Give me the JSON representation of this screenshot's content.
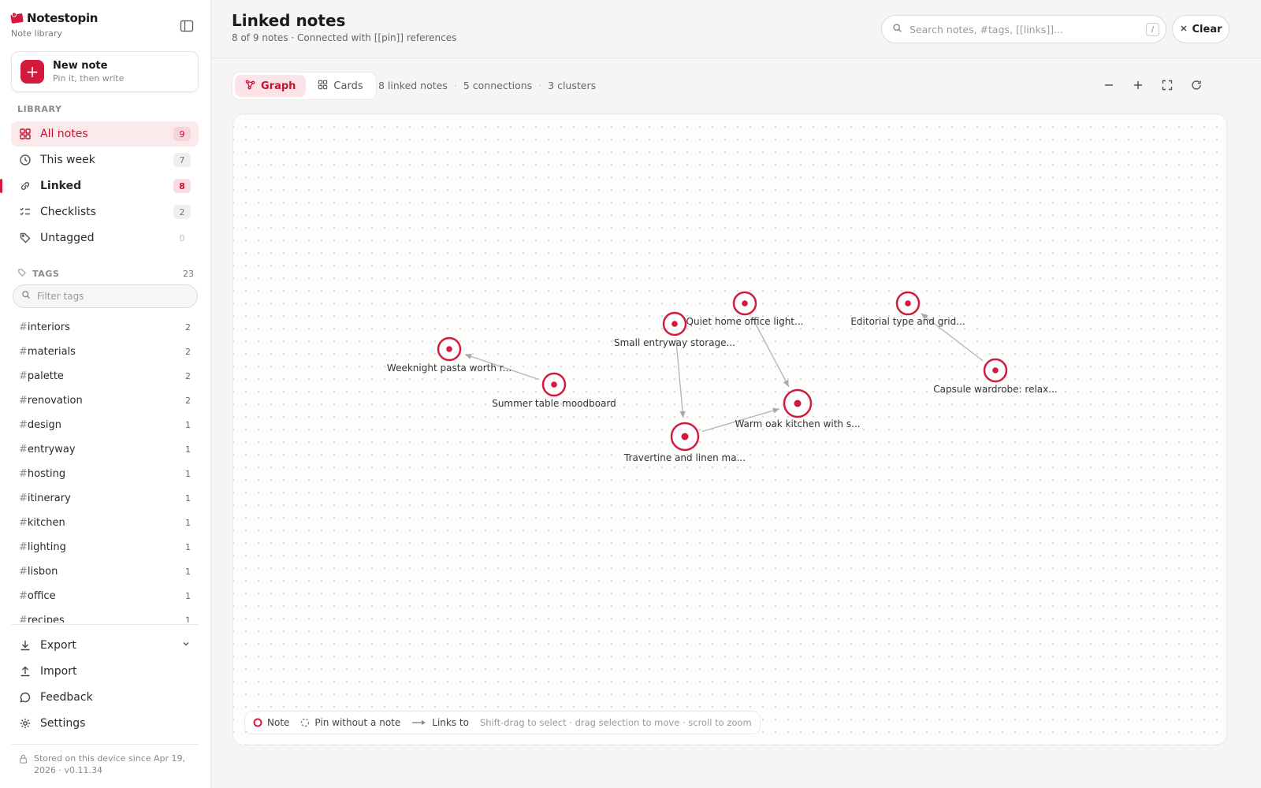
{
  "app": {
    "brand": "Notestopin",
    "brand_sub": "Note library",
    "accent": "#d41a3c"
  },
  "sidebar": {
    "new_note": {
      "title": "New note",
      "sub": "Pin it, then write"
    },
    "library_label": "LIBRARY",
    "nav": [
      {
        "label": "All notes",
        "count": "9",
        "icon": "grid-icon"
      },
      {
        "label": "This week",
        "count": "7",
        "icon": "clock-icon"
      },
      {
        "label": "Linked",
        "count": "8",
        "icon": "link-icon"
      },
      {
        "label": "Checklists",
        "count": "2",
        "icon": "checklist-icon"
      },
      {
        "label": "Untagged",
        "count": "0",
        "icon": "tag-off-icon"
      }
    ],
    "tags_label": "TAGS",
    "tags_count": "23",
    "tag_filter_placeholder": "Filter tags",
    "tags": [
      {
        "name": "interiors",
        "count": "2"
      },
      {
        "name": "materials",
        "count": "2"
      },
      {
        "name": "palette",
        "count": "2"
      },
      {
        "name": "renovation",
        "count": "2"
      },
      {
        "name": "design",
        "count": "1"
      },
      {
        "name": "entryway",
        "count": "1"
      },
      {
        "name": "hosting",
        "count": "1"
      },
      {
        "name": "itinerary",
        "count": "1"
      },
      {
        "name": "kitchen",
        "count": "1"
      },
      {
        "name": "lighting",
        "count": "1"
      },
      {
        "name": "lisbon",
        "count": "1"
      },
      {
        "name": "office",
        "count": "1"
      },
      {
        "name": "recipes",
        "count": "1"
      }
    ],
    "bottom": [
      {
        "label": "Export",
        "icon": "download-icon"
      },
      {
        "label": "Import",
        "icon": "upload-icon"
      },
      {
        "label": "Feedback",
        "icon": "message-icon"
      },
      {
        "label": "Settings",
        "icon": "gear-icon"
      }
    ],
    "footer": "Stored on this device since Apr 19, 2026 · v0.11.34"
  },
  "header": {
    "title": "Linked notes",
    "subtitle": "8 of 9 notes · Connected with [[pin]] references",
    "search_placeholder": "Search notes, #tags, [[links]]...",
    "search_kbd": "/",
    "clear_label": "Clear"
  },
  "view": {
    "tabs": [
      {
        "label": "Graph"
      },
      {
        "label": "Cards"
      }
    ],
    "stats": [
      "8 linked notes",
      "5 connections",
      "3 clusters"
    ]
  },
  "graph": {
    "nodes": [
      {
        "id": "pasta",
        "label": "Weeknight pasta worth r..."
      },
      {
        "id": "summer",
        "label": "Summer table moodboard"
      },
      {
        "id": "entry",
        "label": "Small entryway storage..."
      },
      {
        "id": "office",
        "label": "Quiet home office light..."
      },
      {
        "id": "oak",
        "label": "Warm oak kitchen with s..."
      },
      {
        "id": "trav",
        "label": "Travertine and linen ma..."
      },
      {
        "id": "edit",
        "label": "Editorial type and grid..."
      },
      {
        "id": "caps",
        "label": "Capsule wardrobe: relax..."
      }
    ],
    "edges": [
      {
        "from": "summer",
        "to": "pasta"
      },
      {
        "from": "entry",
        "to": "trav"
      },
      {
        "from": "office",
        "to": "oak"
      },
      {
        "from": "trav",
        "to": "oak"
      },
      {
        "from": "caps",
        "to": "edit"
      }
    ]
  },
  "legend": {
    "note": "Note",
    "pin": "Pin without a note",
    "links": "Links to",
    "hint": "Shift-drag to select · drag selection to move · scroll to zoom"
  }
}
